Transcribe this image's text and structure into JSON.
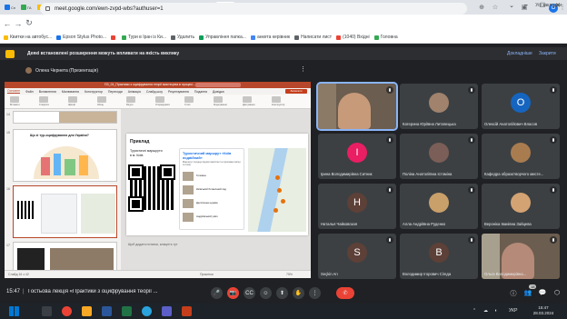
{
  "browser": {
    "tabs": [
      {
        "label": "Сн",
        "color": "#1a73e8"
      },
      {
        "label": "ГА",
        "color": "#34a853"
      },
      {
        "label": "Сс",
        "color": "#fbbc04"
      },
      {
        "label": "Рі",
        "color": "#0f9d58"
      },
      {
        "label": "Uk",
        "color": "#4285f4"
      },
      {
        "label": "Рі",
        "color": "#0f9d58"
      },
      {
        "label": "Ві",
        "color": "#ea4335"
      },
      {
        "label": "Кі",
        "color": "#5f6368"
      },
      {
        "label": "Кі",
        "color": "#5f6368"
      },
      {
        "label": "Se",
        "color": "#1a73e8"
      },
      {
        "label": "Th",
        "color": "#ea4335"
      },
      {
        "label": "Rr",
        "color": "#0b57d0"
      },
      {
        "label": "Ш",
        "color": "#34a853"
      },
      {
        "label": "Кі",
        "color": "#5f6368"
      },
      {
        "label": "Рс",
        "color": "#4285f4"
      },
      {
        "label": "Ні",
        "color": "#fbbc04"
      }
    ],
    "active_tab": {
      "label": "",
      "color": "#00897b"
    },
    "new_tab": "+",
    "window_controls": [
      "⌄",
      "–",
      "☐",
      "✕"
    ],
    "url": "meet.google.com/ewn-zvpd-wbs?authuser=1",
    "nav": {
      "back": "←",
      "forward": "→",
      "reload": "↻",
      "home": "⌂"
    },
    "right_icons": [
      "⊕",
      "☆",
      "▣",
      "⋮"
    ],
    "profile_initial": "O",
    "bookmarks": [
      {
        "label": "Квитки на автобус...",
        "color": "#fbbc04"
      },
      {
        "label": "Epson Stylus Photo...",
        "color": "#1a73e8"
      },
      {
        "label": "",
        "color": "#ea4335"
      },
      {
        "label": "Тури в Іран із Ки...",
        "color": "#34a853"
      },
      {
        "label": "Удалить",
        "color": "#5f6368"
      },
      {
        "label": "Управління папка...",
        "color": "#0f9d58"
      },
      {
        "label": "анкета керівник",
        "color": "#4285f4"
      },
      {
        "label": "Написати лист",
        "color": "#5f6368"
      },
      {
        "label": "(1040) Вхідні",
        "color": "#ea4335"
      },
      {
        "label": "Головна",
        "color": "#34a853"
      }
    ],
    "all_bookmarks": "Усі закладки"
  },
  "meet": {
    "extension_banner": {
      "text": "Деякі встановлені розширення можуть впливати на якість виклику",
      "details": "Докладніше",
      "close": "Закрити"
    },
    "presenter_label": "Олена Чернета (Презентація)",
    "more": "⋮",
    "meeting_time": "15:47",
    "separator": "|",
    "meeting_name": "Гостьова лекція «Практики з оцифрування теорії ...",
    "participants_count": "18",
    "participants": [
      {
        "name": "",
        "initial": "",
        "color": "#6b5d4f",
        "video": true
      },
      {
        "name": "Катерина Юріївна Литовецька",
        "initial": "",
        "color": "#a0826d",
        "video": false,
        "photo": true
      },
      {
        "name": "Олексій Анатолійович Власов",
        "initial": "О",
        "color": "#1565c0",
        "video": false
      },
      {
        "name": "Ірина Володимирівна Ситник",
        "initial": "І",
        "color": "#e91e63",
        "video": false
      },
      {
        "name": "Поліна Анатоліївна Істоміна",
        "initial": "",
        "color": "#7b5e57",
        "video": false,
        "photo": true
      },
      {
        "name": "Кафедра образотворчого мисте...",
        "initial": "",
        "color": "#a97c50",
        "video": false,
        "photo": true
      },
      {
        "name": "Наталья Чайковская",
        "initial": "Н",
        "color": "#5d4037",
        "video": false
      },
      {
        "name": "Алла Андріївна Руденко",
        "initial": "",
        "color": "#c9a06a",
        "video": false,
        "photo": true
      },
      {
        "name": "Вероніка Іванівна Зайцева",
        "initial": "",
        "color": "#d4a373",
        "video": false,
        "photo": true
      },
      {
        "name": "Seçkin Arı",
        "initial": "S",
        "color": "#5d4037",
        "video": false
      },
      {
        "name": "Володимир Ігорович Сігеда",
        "initial": "В",
        "color": "#5d4037",
        "video": false
      },
      {
        "name": "Ольга Володимирівна...",
        "initial": "",
        "color": "#8d6e63",
        "video": true
      }
    ],
    "controls": [
      "🎤",
      "📷",
      "CC",
      "✋",
      "⬆",
      "⋮",
      "✆"
    ],
    "right_controls": [
      "ⓘ",
      "👥",
      "💬",
      "⬡",
      "⚐"
    ]
  },
  "powerpoint": {
    "title": "ПЗ_01_Практики з оцифрування теорії мистецтва в процесі...",
    "present_label": "Записати",
    "menu": [
      "Файл",
      "Вставлення",
      "Малювання",
      "Конструктор",
      "Переходи",
      "Анімація",
      "Слайд-шоу",
      "Рецензування",
      "Подання",
      "Довідка"
    ],
    "active_menu": "Основне",
    "ribbon_labels": [
      "Вставити",
      "Створити",
      "Шрифт",
      "Абзац",
      "Фігури",
      "Упорядкувати",
      "Стилі",
      "Редагування",
      "Диктування",
      "Конструктор"
    ],
    "thumbnail_numbers": [
      "14",
      "15",
      "16",
      "17"
    ],
    "thumb15_title": "Що зі тур-оцифрування для України?",
    "slide": {
      "heading": "Приклад",
      "left_text": "Туристичні маршрути в м. Київ",
      "card_title": "Туристичний маршрут «Київ подвійний»",
      "card_text": "Маршрут поєднує відомі пам'ятки та приховані місця столиці",
      "list_items": [
        "Головна",
        "Київський ботанічний сад",
        "Десятинна церква",
        "Андріївський узвіз"
      ]
    },
    "notes": "Щоб додати нотатки, клацніть тут",
    "status": "Слайд 16 з 42",
    "status_right": "Примітки",
    "zoom": "75%"
  },
  "taskbar": {
    "apps": [
      {
        "name": "start",
        "color": "#0078d4"
      },
      {
        "name": "search",
        "color": "#3a3f45"
      },
      {
        "name": "chrome",
        "color": "#ea4335"
      },
      {
        "name": "explorer",
        "color": "#f9a825"
      },
      {
        "name": "word",
        "color": "#2b579a"
      },
      {
        "name": "excel",
        "color": "#217346"
      },
      {
        "name": "telegram",
        "color": "#2aa3dd"
      },
      {
        "name": "teams",
        "color": "#5b5fc7"
      },
      {
        "name": "powerpoint",
        "color": "#c43e1c"
      }
    ],
    "lang": "УКР",
    "time": "15:47",
    "date": "28.03.2024"
  }
}
